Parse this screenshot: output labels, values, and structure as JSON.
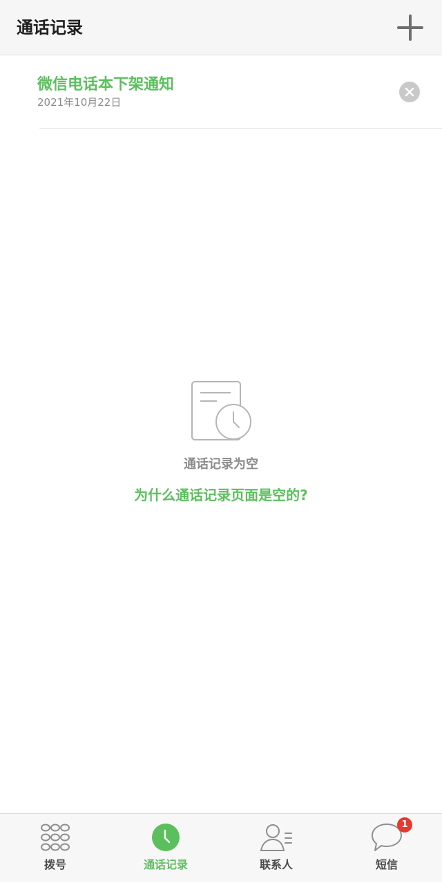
{
  "header": {
    "title": "通话记录",
    "add_icon": "plus-icon"
  },
  "notice": {
    "title": "微信电话本下架通知",
    "date": "2021年10月22日",
    "close_icon": "close-circle-icon"
  },
  "empty_state": {
    "icon": "call-log-clock-icon",
    "text": "通话记录为空",
    "link": "为什么通话记录页面是空的?"
  },
  "tabbar": {
    "tabs": [
      {
        "label": "拨号",
        "icon": "dialpad-icon",
        "active": false
      },
      {
        "label": "通话记录",
        "icon": "clock-icon",
        "active": true
      },
      {
        "label": "联系人",
        "icon": "contacts-icon",
        "active": false
      },
      {
        "label": "短信",
        "icon": "message-bubble-icon",
        "active": false,
        "badge": "1"
      }
    ]
  },
  "colors": {
    "accent": "#5cbf5e",
    "badge": "#e53a2f",
    "icon_gray": "#8e8e8e"
  }
}
